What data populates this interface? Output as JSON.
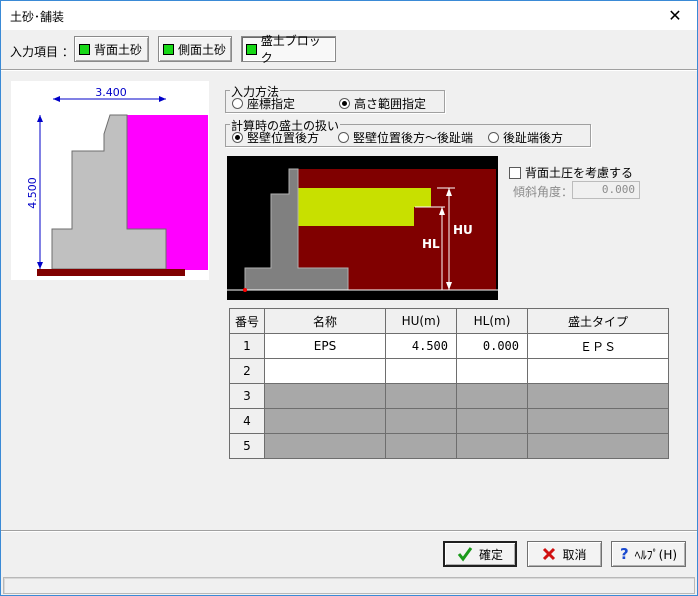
{
  "window": {
    "title": "土砂･舗装",
    "close_glyph": "✕"
  },
  "input_items": {
    "label": "入力項目 ：",
    "tabs": [
      {
        "label": "背面土砂"
      },
      {
        "label": "側面土砂"
      },
      {
        "label": "盛土ブロック"
      }
    ],
    "active_tab": "盛土ブロック"
  },
  "preview": {
    "dim_width": "3.400",
    "dim_height": "4.500"
  },
  "input_method": {
    "title": "入力方法",
    "options": [
      "座標指定",
      "高さ範囲指定"
    ],
    "selected": "高さ範囲指定"
  },
  "fill_handling": {
    "title": "計算時の盛土の扱い",
    "options": [
      "竪壁位置後方",
      "竪壁位置後方～後趾端",
      "後趾端後方"
    ],
    "selected": "竪壁位置後方"
  },
  "diagram": {
    "hu_label": "HU",
    "hl_label": "HL"
  },
  "back_pressure": {
    "label": "背面土圧を考慮する",
    "checked": false
  },
  "tilt": {
    "label": "傾斜角度：",
    "value": "0.000"
  },
  "table": {
    "headers": [
      "番号",
      "名称",
      "HU(m)",
      "HL(m)",
      "盛土タイプ"
    ],
    "rows": [
      {
        "no": "1",
        "name": "EPS",
        "hu": "4.500",
        "hl": "0.000",
        "type": "ＥＰＳ",
        "enabled": true
      },
      {
        "no": "2",
        "name": "",
        "hu": "",
        "hl": "",
        "type": "",
        "enabled": true
      },
      {
        "no": "3",
        "name": "",
        "hu": "",
        "hl": "",
        "type": "",
        "enabled": false
      },
      {
        "no": "4",
        "name": "",
        "hu": "",
        "hl": "",
        "type": "",
        "enabled": false
      },
      {
        "no": "5",
        "name": "",
        "hu": "",
        "hl": "",
        "type": "",
        "enabled": false
      }
    ]
  },
  "buttons": {
    "ok": "確定",
    "cancel": "取消",
    "help": "ﾍﾙﾌﾟ(H)"
  },
  "colors": {
    "fill_magenta": "#ff00ff",
    "wall_gray": "#c0c0c0",
    "diagram_dark_red": "#800000",
    "eps_yellow": "#c8e000",
    "check_green": "#18d818"
  }
}
